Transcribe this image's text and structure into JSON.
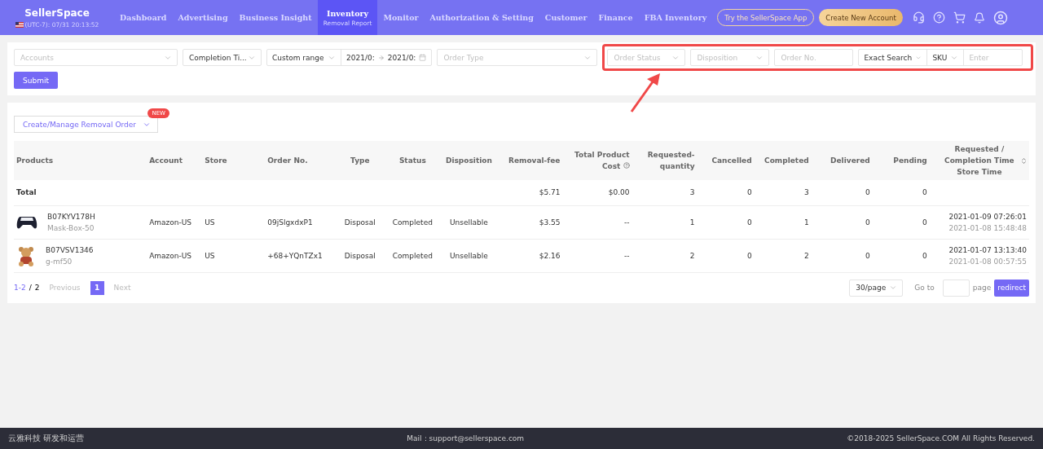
{
  "brand": {
    "name": "SellerSpace",
    "clock": "(UTC-7): 07/31 20:13:52"
  },
  "nav": [
    {
      "label": "Dashboard",
      "selected": false
    },
    {
      "label": "Advertising",
      "selected": false
    },
    {
      "label": "Business Insight",
      "selected": false
    },
    {
      "label": "Inventory",
      "selected": true,
      "sub": "Removal Report"
    },
    {
      "label": "Monitor",
      "selected": false
    },
    {
      "label": "Authorization & Setting",
      "selected": false
    },
    {
      "label": "Customer",
      "selected": false
    },
    {
      "label": "Finance",
      "selected": false
    },
    {
      "label": "FBA Inventory",
      "selected": false
    }
  ],
  "header_buttons": [
    {
      "label": "Try the SellerSpace App",
      "kind": "outline"
    },
    {
      "label": "Create New Account",
      "kind": "gold"
    }
  ],
  "filters": [
    {
      "kind": "select",
      "placeholder": "Accounts"
    },
    {
      "kind": "select",
      "value": "Completion Ti..."
    },
    {
      "kind": "range",
      "mode": "Custom range",
      "start": "2021/0:",
      "end": "2021/0:"
    },
    {
      "kind": "select",
      "placeholder": "Order Type"
    }
  ],
  "highlighted_filters": [
    {
      "kind": "select",
      "placeholder": "Order Status"
    },
    {
      "kind": "select",
      "placeholder": "Disposition"
    },
    {
      "kind": "input",
      "placeholder": "Order No."
    },
    {
      "kind": "search",
      "mode": "Exact Search",
      "field": "SKU",
      "placeholder": "Enter"
    }
  ],
  "submit": "Submit",
  "manage_button": {
    "label": "Create/Manage Removal Order",
    "badge": "NEW"
  },
  "table": {
    "columns": [
      {
        "label": "Products"
      },
      {
        "label": "Account"
      },
      {
        "label": "Store"
      },
      {
        "label": "Order No."
      },
      {
        "label": "Type"
      },
      {
        "label": "Status"
      },
      {
        "label": "Disposition"
      },
      {
        "label": "Removal-fee"
      },
      {
        "label": "Total Product Cost",
        "help": true
      },
      {
        "label": "Requested-quantity"
      },
      {
        "label": "Cancelled"
      },
      {
        "label": "Completed"
      },
      {
        "label": "Delivered"
      },
      {
        "label": "Pending"
      },
      {
        "label": "Requested / Completion Time Store Time",
        "sortable": true
      }
    ],
    "total": {
      "label": "Total",
      "removal_fee": "$5.71",
      "total_cost": "$0.00",
      "requested": "3",
      "cancelled": "0",
      "completed": "3",
      "delivered": "0",
      "pending": "0"
    },
    "rows": [
      {
        "kind": "gamepad",
        "asin": "B07KYV178H",
        "sku": "Mask-Box-50",
        "account": "Amazon-US",
        "store": "US",
        "order_no": "09jSlgxdxP1",
        "type": "Disposal",
        "status": "Completed",
        "disposition": "Unsellable",
        "removal_fee": "$3.55",
        "total_cost": "--",
        "requested": "1",
        "cancelled": "0",
        "completed": "1",
        "delivered": "0",
        "pending": "0",
        "time": "2021-01-09 07:26:01",
        "store_time": "2021-01-08 15:48:48"
      },
      {
        "kind": "teddy",
        "asin": "B07VSV1346",
        "sku": "g-mf50",
        "account": "Amazon-US",
        "store": "US",
        "order_no": "+68+YQnTZx1",
        "type": "Disposal",
        "status": "Completed",
        "disposition": "Unsellable",
        "removal_fee": "$2.16",
        "total_cost": "--",
        "requested": "2",
        "cancelled": "0",
        "completed": "2",
        "delivered": "0",
        "pending": "0",
        "time": "2021-01-07 13:13:40",
        "store_time": "2021-01-08 00:57:55"
      }
    ]
  },
  "pagination": {
    "range": "1-2",
    "separator": "/",
    "total": "2",
    "previous": "Previous",
    "pages": [
      {
        "label": "1",
        "selected": true
      }
    ],
    "next": "Next",
    "page_size": "30/page",
    "goto": "Go to",
    "page": "page",
    "redirect": "redirect"
  },
  "footer": {
    "left": "云雅科技 研发和运营",
    "mail": "Mail：support@sellerspace.com",
    "copyright": "©2018-2025 SellerSpace.COM All Rights Reserved."
  }
}
